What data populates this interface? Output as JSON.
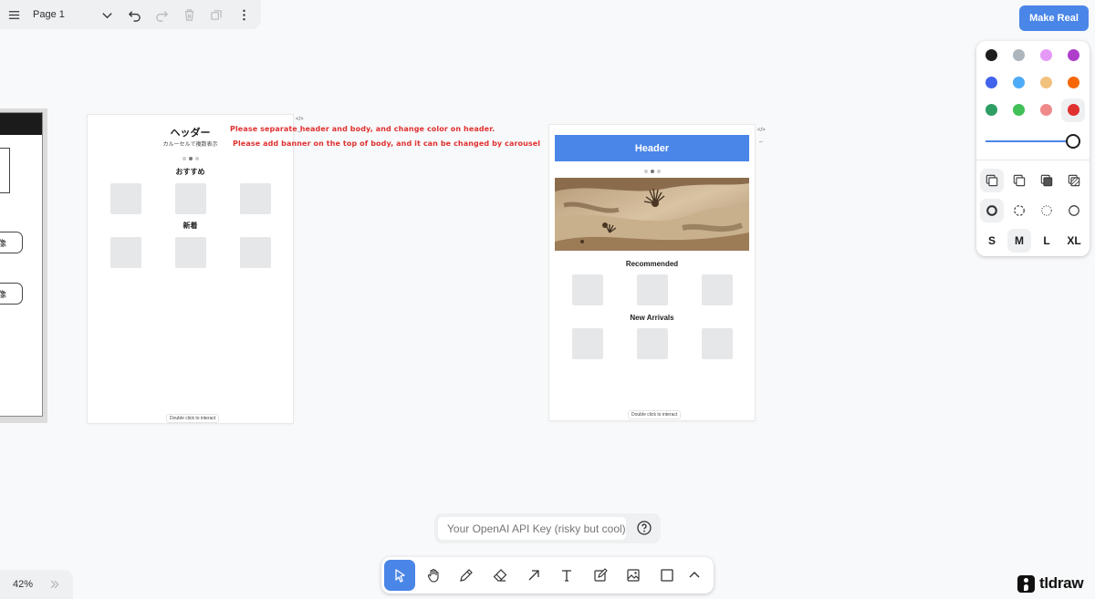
{
  "menu": {
    "page_name": "Page 1"
  },
  "make_real": {
    "label": "Make Real"
  },
  "style_panel": {
    "colors": [
      "#1d1d1d",
      "#adb5bd",
      "#e599f7",
      "#ae3ec9",
      "#4263eb",
      "#4dabf7",
      "#f2c17d",
      "#f76707",
      "#2f9e64",
      "#40c057",
      "#f08a8a",
      "#e03131"
    ],
    "selected_color": "#e03131",
    "opacity": 1,
    "sizes": [
      "S",
      "M",
      "L",
      "XL"
    ],
    "selected_size": "M"
  },
  "left_frame": {
    "button_text": "像"
  },
  "card1": {
    "header": "ヘッダー",
    "subtitle": "カルーセルで複数表示",
    "section1": "おすすめ",
    "section2": "新着",
    "interact": "Double click to interact"
  },
  "card2": {
    "header": "Header",
    "section1": "Recommended",
    "section2": "New Arrivals",
    "interact": "Double click to interact"
  },
  "annotations": {
    "line1": "Please separate header and body, and change color on header.",
    "line2": "Please add banner on the top of body, and it can be changed by carousel"
  },
  "api_key": {
    "placeholder": "Your OpenAI API Key (risky but cool)"
  },
  "zoom": {
    "value": "42%"
  },
  "brand": {
    "name": "tldraw"
  },
  "colors": {
    "accent": "#4a86e8",
    "annotation": "#e03131"
  }
}
